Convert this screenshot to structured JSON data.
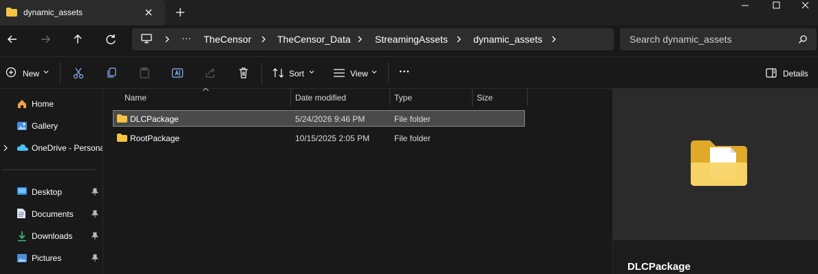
{
  "window": {
    "tab_title": "dynamic_assets",
    "new_tab": "+",
    "controls": {
      "minimize": "–",
      "maximize": "☐",
      "close": "✕"
    }
  },
  "address": {
    "more": "···",
    "breadcrumbs": [
      "TheCensor",
      "TheCensor_Data",
      "StreamingAssets",
      "dynamic_assets"
    ],
    "search_placeholder": "Search dynamic_assets"
  },
  "commandbar": {
    "new_label": "New",
    "sort_label": "Sort",
    "view_label": "View",
    "more": "···",
    "details_label": "Details"
  },
  "nav": {
    "quick": [
      {
        "label": "Home",
        "icon": "home-icon"
      },
      {
        "label": "Gallery",
        "icon": "gallery-icon"
      },
      {
        "label": "OneDrive - Persona",
        "icon": "onedrive-icon"
      }
    ],
    "pinned": [
      {
        "label": "Desktop",
        "icon": "desktop-icon"
      },
      {
        "label": "Documents",
        "icon": "documents-icon"
      },
      {
        "label": "Downloads",
        "icon": "downloads-icon"
      },
      {
        "label": "Pictures",
        "icon": "pictures-icon"
      }
    ]
  },
  "columns": {
    "name": "Name",
    "date": "Date modified",
    "type": "Type",
    "size": "Size"
  },
  "files": [
    {
      "name": "DLCPackage",
      "date": "5/24/2026 9:46 PM",
      "type": "File folder",
      "size": ""
    },
    {
      "name": "RootPackage",
      "date": "10/15/2025 2:05 PM",
      "type": "File folder",
      "size": ""
    }
  ],
  "details_pane": {
    "title": "DLCPackage"
  },
  "colors": {
    "folder": "#f5c542",
    "accent": "#4cc2ff",
    "selection": "#4a4a4a"
  }
}
